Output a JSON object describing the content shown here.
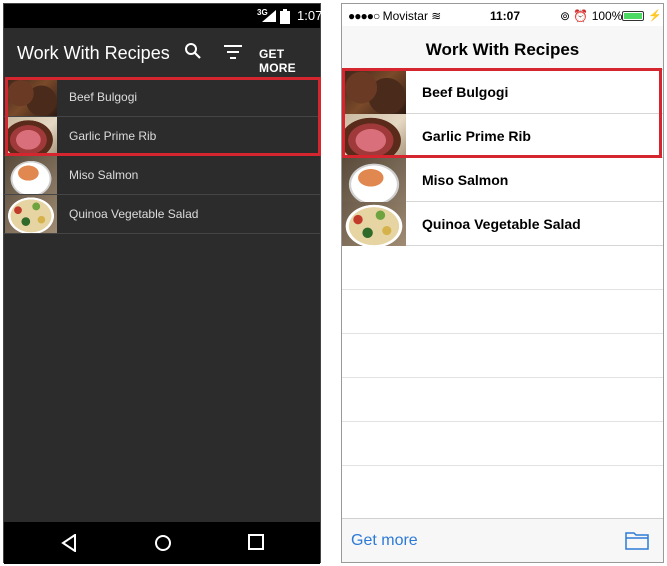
{
  "android": {
    "status": {
      "network": "3G",
      "time": "1:07"
    },
    "appbar": {
      "title": "Work With Recipes",
      "get_more": "GET MORE"
    },
    "recipes": [
      {
        "label": "Beef Bulgogi",
        "thumb": "beef-bulgogi"
      },
      {
        "label": "Garlic Prime Rib",
        "thumb": "garlic-prime-rib"
      },
      {
        "label": "Miso Salmon",
        "thumb": "miso-salmon"
      },
      {
        "label": "Quinoa Vegetable Salad",
        "thumb": "quinoa-salad"
      }
    ],
    "nav": [
      "back-icon",
      "home-icon",
      "recents-icon"
    ]
  },
  "ios": {
    "status": {
      "carrier": "Movistar",
      "time": "11:07",
      "battery": "100%"
    },
    "navbar": {
      "title": "Work With Recipes"
    },
    "recipes": [
      {
        "label": "Beef Bulgogi",
        "thumb": "beef-bulgogi"
      },
      {
        "label": "Garlic Prime Rib",
        "thumb": "garlic-prime-rib"
      },
      {
        "label": "Miso Salmon",
        "thumb": "miso-salmon"
      },
      {
        "label": "Quinoa Vegetable Salad",
        "thumb": "quinoa-salad"
      }
    ],
    "toolbar": {
      "get_more": "Get more"
    }
  },
  "colors": {
    "highlight": "#d5262f",
    "ios_tint": "#2d7ad6",
    "android_bg": "#2c2c2c"
  }
}
